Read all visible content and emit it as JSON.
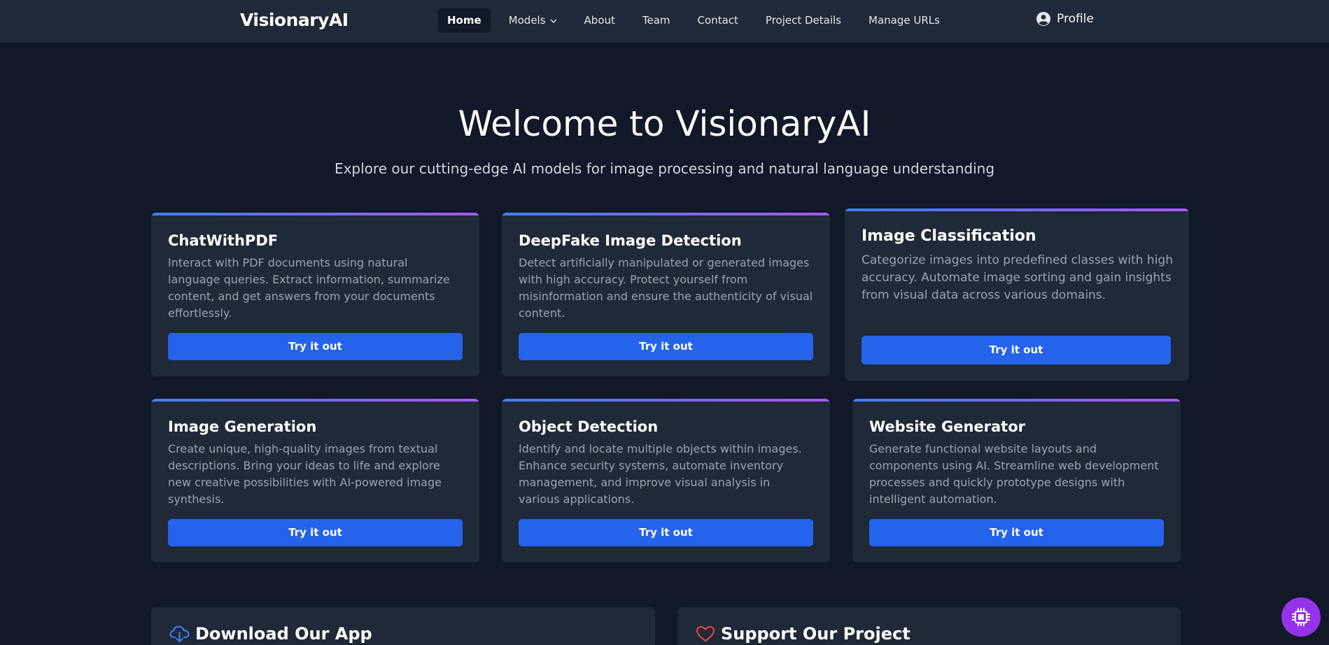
{
  "nav": {
    "brand": "VisionaryAI",
    "links": [
      {
        "label": "Home"
      },
      {
        "label": "Models"
      },
      {
        "label": "About"
      },
      {
        "label": "Team"
      },
      {
        "label": "Contact"
      },
      {
        "label": "Project Details"
      },
      {
        "label": "Manage URLs"
      }
    ],
    "profile_label": "Profile"
  },
  "hero": {
    "title": "Welcome to VisionaryAI",
    "subtitle": "Explore our cutting-edge AI models for image processing and natural language understanding"
  },
  "cards": [
    {
      "title": "ChatWithPDF",
      "description": "Interact with PDF documents using natural language queries. Extract information, summarize content, and get answers from your documents effortlessly.",
      "button": "Try it out"
    },
    {
      "title": "DeepFake Image Detection",
      "description": "Detect artificially manipulated or generated images with high accuracy. Protect yourself from misinformation and ensure the authenticity of visual content.",
      "button": "Try it out"
    },
    {
      "title": "Image Classification",
      "description": "Categorize images into predefined classes with high accuracy. Automate image sorting and gain insights from visual data across various domains.",
      "button": "Try it out"
    },
    {
      "title": "Image Generation",
      "description": "Create unique, high-quality images from textual descriptions. Bring your ideas to life and explore new creative possibilities with AI-powered image synthesis.",
      "button": "Try it out"
    },
    {
      "title": "Object Detection",
      "description": "Identify and locate multiple objects within images. Enhance security systems, automate inventory management, and improve visual analysis in various applications.",
      "button": "Try it out"
    },
    {
      "title": "Website Generator",
      "description": "Generate functional website layouts and components using AI. Streamline web development processes and quickly prototype designs with intelligent automation.",
      "button": "Try it out"
    }
  ],
  "sections": {
    "download_title": "Download Our App",
    "support_title": "Support Our Project"
  },
  "icons": {
    "models_dropdown": "chevron-down-icon",
    "profile": "user-circle-icon",
    "download": "cloud-download-icon",
    "support": "heart-icon",
    "fab": "chip-icon"
  },
  "colors": {
    "background": "#111827",
    "surface": "#1f2937",
    "primary": "#2563eb",
    "accent_gradient_start": "#3b82f6",
    "accent_gradient_end": "#a855f7",
    "fab": "#9333ea",
    "heart": "#ef4444",
    "download_icon": "#3b82f6"
  }
}
